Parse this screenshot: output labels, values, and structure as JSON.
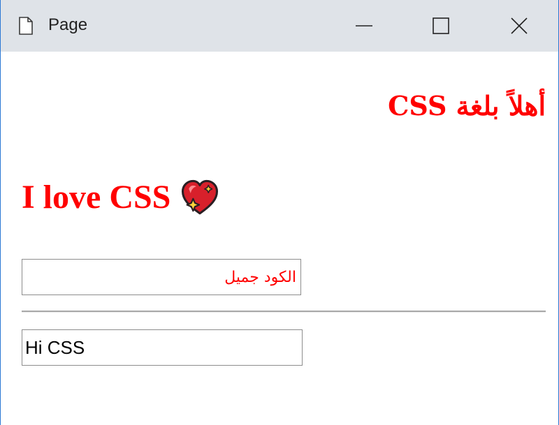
{
  "window": {
    "title": "Page"
  },
  "page": {
    "heading_rtl": "أهلاً بلغة CSS",
    "heading_love": "I love CSS",
    "emoji_icon": "sparkling-heart",
    "rtl_input": {
      "value": "",
      "placeholder": "الكود جميل"
    },
    "ltr_input": {
      "value": "Hi CSS",
      "placeholder": ""
    }
  },
  "colors": {
    "text_red": "#ff0000",
    "titlebar_bg": "#dfe3e8",
    "border_blue": "#2b78d4"
  }
}
